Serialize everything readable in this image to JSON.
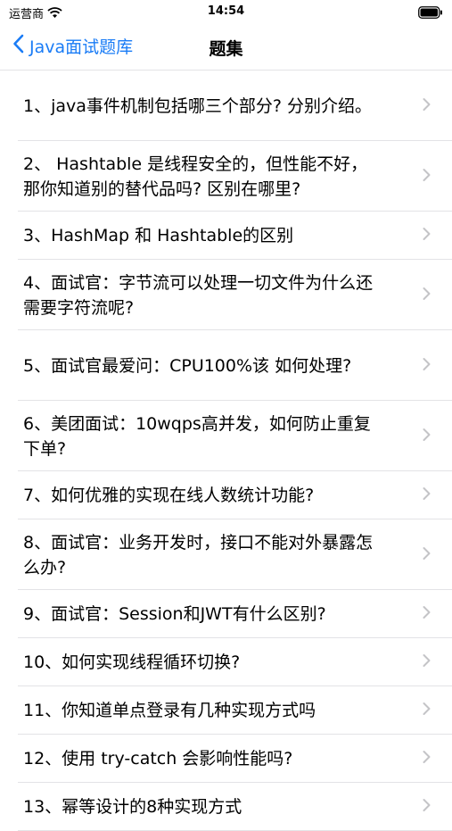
{
  "status_bar": {
    "carrier": "运营商",
    "time": "14:54"
  },
  "nav": {
    "back_label": "Java面试题库",
    "title": "题集"
  },
  "items": [
    {
      "label": "1、java事件机制包括哪三个部分? 分别介绍。"
    },
    {
      "label": "2、 Hashtable 是线程安全的，但性能不好，那你知道别的替代品吗? 区别在哪里?"
    },
    {
      "label": "3、HashMap 和 Hashtable的区别"
    },
    {
      "label": "4、面试官：字节流可以处理一切文件为什么还需要字符流呢?"
    },
    {
      "label": "5、面试官最爱问：CPU100%该 如何处理?"
    },
    {
      "label": "6、美团面试：10wqps高并发，如何防止重复下单?"
    },
    {
      "label": "7、如何优雅的实现在线人数统计功能?"
    },
    {
      "label": "8、面试官：业务开发时，接口不能对外暴露怎么办?"
    },
    {
      "label": "9、面试官：Session和JWT有什么区别?"
    },
    {
      "label": "10、如何实现线程循环切换?"
    },
    {
      "label": "11、你知道单点登录有几种实现方式吗"
    },
    {
      "label": "12、使用 try-catch 会影响性能吗?"
    },
    {
      "label": "13、幂等设计的8种实现方式"
    }
  ],
  "colors": {
    "accent": "#1a7cf6",
    "separator": "#e3e3e6",
    "chevron": "#c4c4c7"
  }
}
